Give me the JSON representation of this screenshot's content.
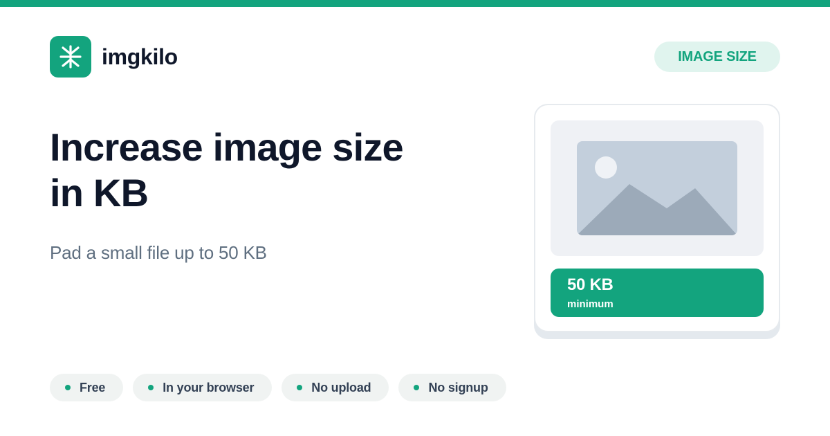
{
  "brand": {
    "name": "imgkilo",
    "logo_icon": "compress-arrows-icon"
  },
  "category": "IMAGE SIZE",
  "headline": {
    "line1": "Increase image size",
    "line2": "in KB"
  },
  "subhead": "Pad a small file up to 50 KB",
  "preview_card": {
    "image_icon": "image-placeholder-icon",
    "size_value": "50 KB",
    "size_caption": "minimum"
  },
  "features": [
    "Free",
    "In your browser",
    "No upload",
    "No signup"
  ],
  "colors": {
    "accent": "#13a47e",
    "accent_soft": "#e0f4ee",
    "heading": "#0f172a",
    "muted": "#5f6f80",
    "chip_bg": "#f0f3f2"
  }
}
